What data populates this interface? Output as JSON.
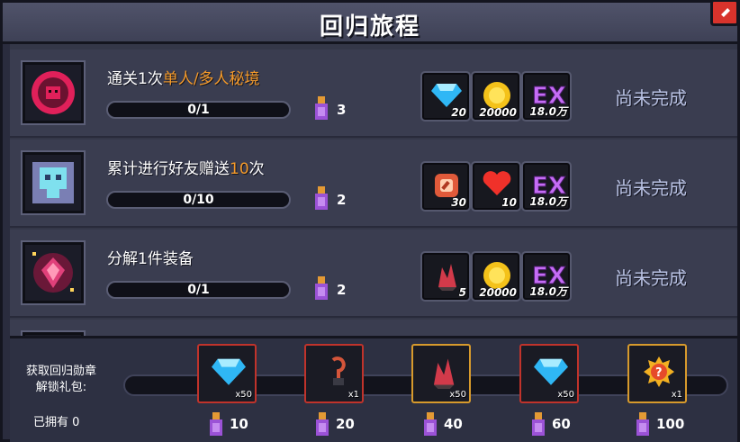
{
  "header": {
    "title": "回归旅程"
  },
  "tasks": [
    {
      "desc_parts": [
        "通关1次",
        "单人/多人秘境",
        ""
      ],
      "progress_text": "0/1",
      "progress": 0,
      "medal_reward": "3",
      "rewards": [
        {
          "icon": "blue-gem-icon",
          "qty": "20"
        },
        {
          "icon": "gold-coin-icon",
          "qty": "20000"
        },
        {
          "icon": "exp-icon",
          "qty": "18.0万"
        }
      ],
      "status": "尚未完成",
      "task_icon": "dungeon-portal-icon"
    },
    {
      "desc_parts": [
        "累计进行好友赠送",
        "10",
        "次"
      ],
      "progress_text": "0/10",
      "progress": 0,
      "medal_reward": "2",
      "rewards": [
        {
          "icon": "material-icon",
          "qty": "30"
        },
        {
          "icon": "heart-icon",
          "qty": "10"
        },
        {
          "icon": "exp-icon",
          "qty": "18.0万"
        }
      ],
      "status": "尚未完成",
      "task_icon": "friend-gift-icon"
    },
    {
      "desc_parts": [
        "分解1件装备",
        "",
        ""
      ],
      "progress_text": "0/1",
      "progress": 0,
      "medal_reward": "2",
      "rewards": [
        {
          "icon": "red-crystal-icon",
          "qty": "5"
        },
        {
          "icon": "gold-coin-icon",
          "qty": "20000"
        },
        {
          "icon": "exp-icon",
          "qty": "18.0万"
        }
      ],
      "status": "尚未完成",
      "task_icon": "equipment-dismantle-icon"
    }
  ],
  "footer": {
    "label": "获取回归勋章解锁礼包:",
    "owned": "已拥有 0",
    "milestones": [
      {
        "cost": "10",
        "icon": "blue-gem-icon",
        "count": "x50",
        "frame": "red"
      },
      {
        "cost": "20",
        "icon": "hook-item-icon",
        "count": "x1",
        "frame": "red"
      },
      {
        "cost": "40",
        "icon": "red-crystal-icon",
        "count": "x50",
        "frame": "gold"
      },
      {
        "cost": "60",
        "icon": "blue-gem-icon",
        "count": "x50",
        "frame": "red"
      },
      {
        "cost": "100",
        "icon": "mystery-chest-icon",
        "count": "x1",
        "frame": "gold"
      }
    ]
  },
  "colors": {
    "highlight": "#f49a2a",
    "status": "#b9c2e4",
    "frame_red": "#c0332b",
    "frame_gold": "#d79a2c"
  }
}
